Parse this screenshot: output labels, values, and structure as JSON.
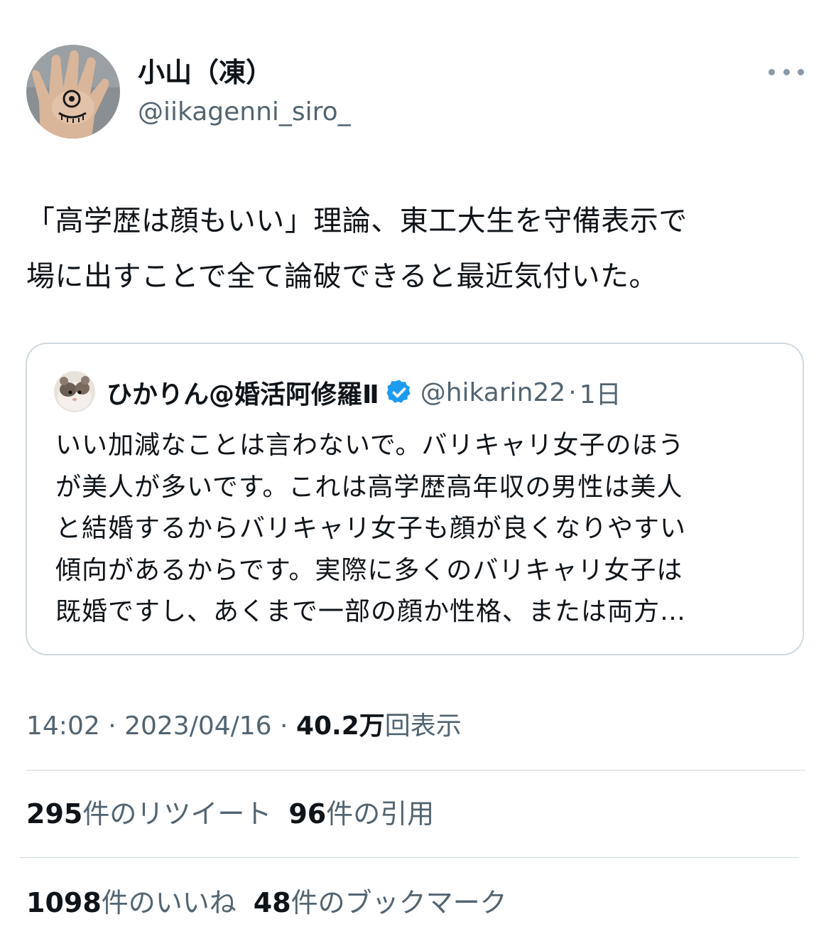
{
  "tweet": {
    "author_name": "小山（凍）",
    "author_handle": "@iikagenni_siro_",
    "more_icon": "more-horizontal-icon",
    "text_line1": "「高学歴は顔もいい」理論、東工大生を守備表示で",
    "text_line2": "場に出すことで全て論破できると最近気付いた。"
  },
  "quote": {
    "author_name": "ひかりん@婚活阿修羅Ⅱ",
    "verified_icon": "verified-badge-icon",
    "author_handle": "@hikarin22",
    "separator": "·",
    "time": "1日",
    "lines": [
      "いい加減なことは言わないで。バリキャリ女子のほう",
      "が美人が多いです。これは高学歴高年収の男性は美人",
      "と結婚するからバリキャリ女子も顔が良くなりやすい",
      "傾向があるからです。実際に多くのバリキャリ女子は",
      "既婚ですし、あくまで一部の顔か性格、または両方…"
    ]
  },
  "meta": {
    "time": "14:02",
    "sep1": " · ",
    "date": "2023/04/16",
    "sep2": " · ",
    "views_count": "40.2万",
    "views_label": "回表示"
  },
  "stats": {
    "retweets_count": "295",
    "retweets_label": "件のリツイート",
    "quotes_count": "96",
    "quotes_label": "件の引用",
    "likes_count": "1098",
    "likes_label": "件のいいね",
    "bookmarks_count": "48",
    "bookmarks_label": "件のブックマーク"
  },
  "colors": {
    "text": "#0f1419",
    "secondary": "#536471",
    "border": "#cfd9de",
    "verified_blue": "#1d9bf0"
  }
}
